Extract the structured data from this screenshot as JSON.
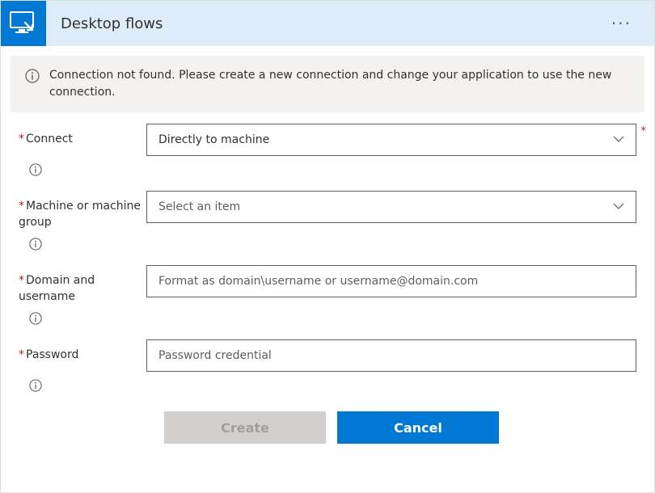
{
  "header": {
    "title": "Desktop flows"
  },
  "alert": {
    "message": "Connection not found. Please create a new connection and change your application to use the new connection."
  },
  "form": {
    "connect": {
      "label": "Connect",
      "value": "Directly to machine"
    },
    "machine": {
      "label": "Machine or machine group",
      "placeholder": "Select an item"
    },
    "domain": {
      "label": "Domain and username",
      "placeholder": "Format as domain\\username or username@domain.com"
    },
    "password": {
      "label": "Password",
      "placeholder": "Password credential"
    }
  },
  "actions": {
    "create": "Create",
    "cancel": "Cancel"
  }
}
